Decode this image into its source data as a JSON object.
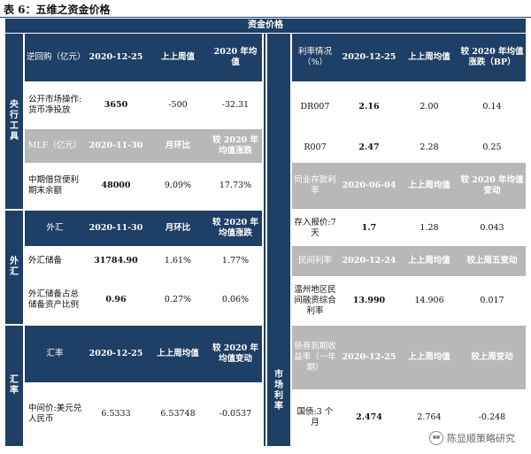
{
  "title": "表 6：五维之资金价格",
  "banner": "资金价格",
  "left": {
    "side_central": "央行工具",
    "side_fx": "外汇",
    "side_rate": "汇率",
    "h1": [
      "逆回购（亿元）",
      "2020-12-25",
      "上上周值",
      "2020 年均值"
    ],
    "r1": [
      "公开市场操作:货币净投放",
      "3650",
      "-500",
      "-32.31"
    ],
    "h2": [
      "MLF（亿元）",
      "2020-11-30",
      "月环比",
      "较 2020 年均值涨跌"
    ],
    "r2": [
      "中期借贷便利期末余额",
      "48000",
      "9.09%",
      "17.73%"
    ],
    "h3": [
      "外汇",
      "2020-11-30",
      "月环比",
      "较 2020 年均值涨跌"
    ],
    "r3": [
      "外汇储备",
      "31784.90",
      "1.61%",
      "1.77%"
    ],
    "r4": [
      "外汇储备占总储备资产比例",
      "0.96",
      "0.27%",
      "0.06%"
    ],
    "h4": [
      "汇率",
      "2020-12-25",
      "上上周均值",
      "较 2020 年均值变动"
    ],
    "r5": [
      "中间价:美元兑人民币",
      "6.5333",
      "6.53748",
      "-0.0537"
    ]
  },
  "right": {
    "side_market": "市场利率",
    "h1": [
      "利率情况（%）",
      "2020-12-25",
      "上上周均值",
      "较 2020 年均值涨跌（BP）"
    ],
    "r1": [
      "DR007",
      "2.16",
      "2.00",
      "0.14"
    ],
    "r2": [
      "R007",
      "2.47",
      "2.28",
      "0.25"
    ],
    "h2": [
      "同业存款利率",
      "2020-06-04",
      "上上周均值",
      "较 2020 年均值变动"
    ],
    "r3": [
      "存入报价:7 天",
      "1.7",
      "1.28",
      "0.043"
    ],
    "h3": [
      "民间利率",
      "2020-12-24",
      "上上周均值",
      "较上周五变动"
    ],
    "r4": [
      "温州地区民间融资综合利率",
      "13.990",
      "14.906",
      "0.017"
    ],
    "h4": [
      "债券到期收益率（一年期）",
      "2020-12-25",
      "上上周均值",
      "较上周变动"
    ],
    "r5": [
      "国债:3 个月",
      "2.474",
      "2.764",
      "-0.248"
    ]
  },
  "watermark": "陈显顺策略研究",
  "colors": {
    "navy": "#1e3f66",
    "gray": "#b8b8b8",
    "red": "#c0202a"
  }
}
